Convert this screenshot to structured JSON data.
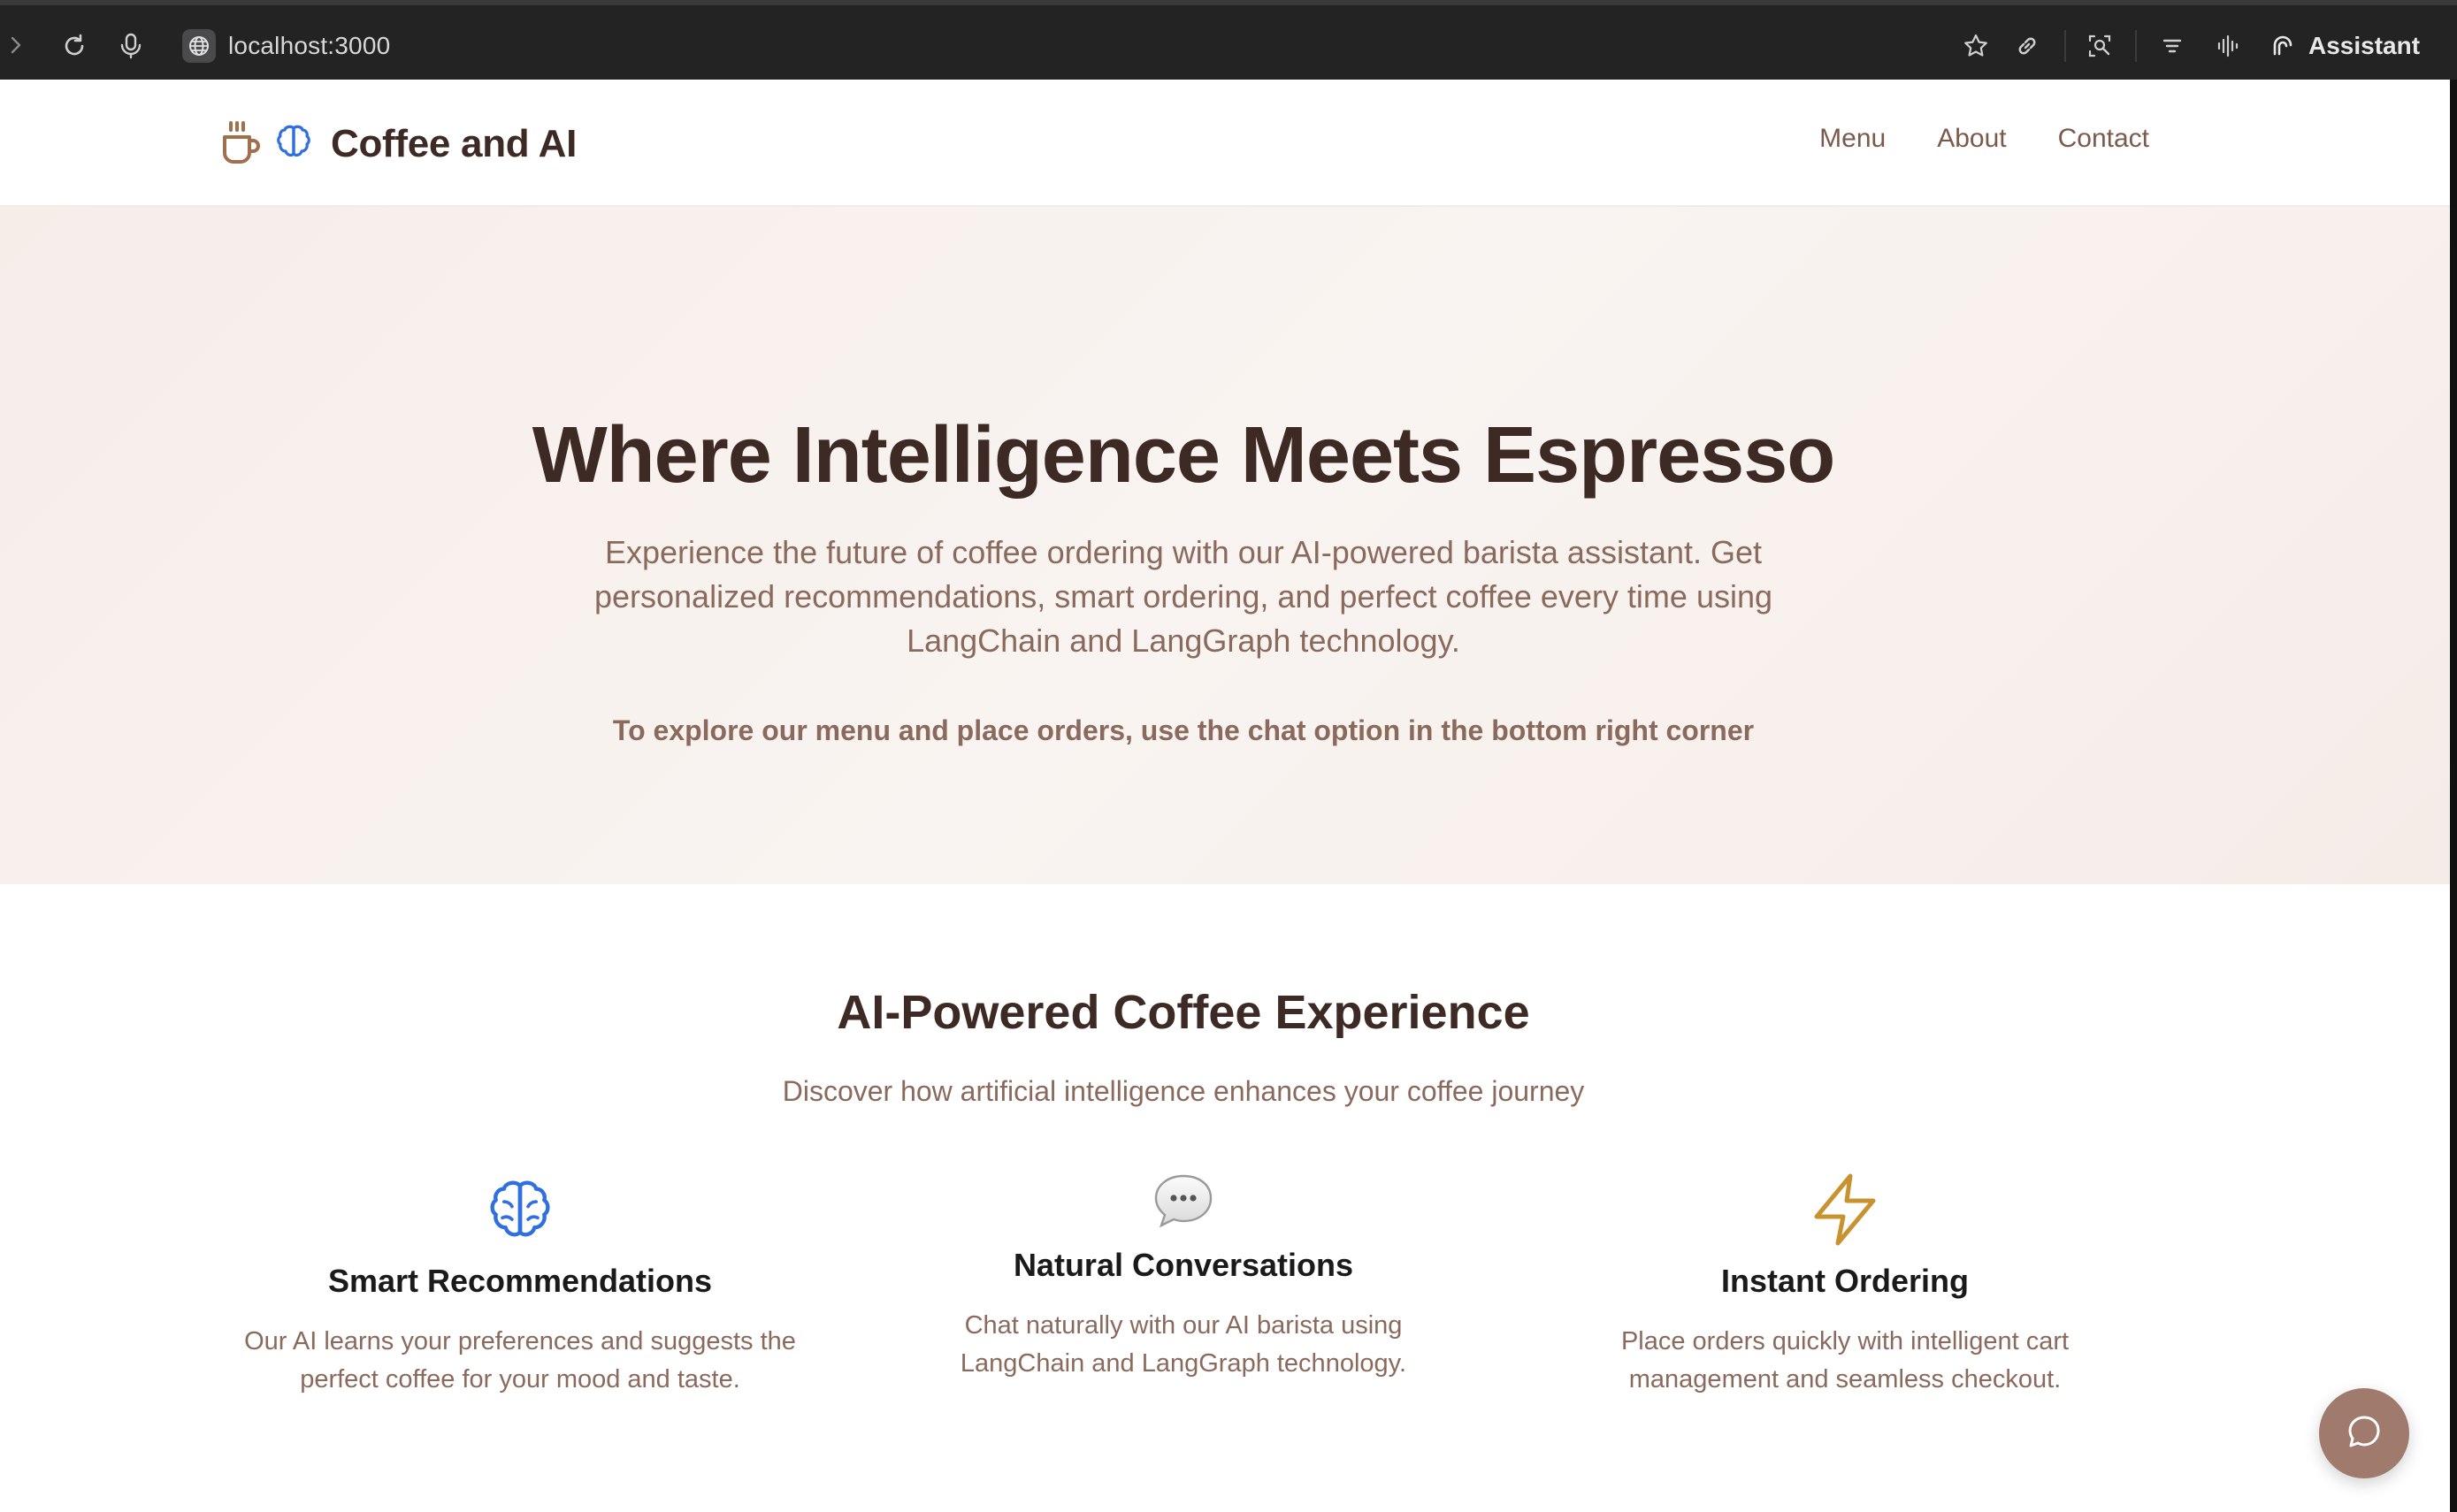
{
  "browser": {
    "url": "localhost:3000",
    "assistant_label": "Assistant"
  },
  "header": {
    "brand_title": "Coffee and AI",
    "nav": [
      "Menu",
      "About",
      "Contact"
    ]
  },
  "hero": {
    "title": "Where Intelligence Meets Espresso",
    "subtitle": "Experience the future of coffee ordering with our AI-powered barista assistant. Get personalized recommendations, smart ordering, and perfect coffee every time using LangChain and LangGraph technology.",
    "note": "To explore our menu and place orders, use the chat option in the bottom right corner"
  },
  "features": {
    "title": "AI-Powered Coffee Experience",
    "subtitle": "Discover how artificial intelligence enhances your coffee journey",
    "items": [
      {
        "icon": "brain-icon",
        "title": "Smart Recommendations",
        "description": "Our AI learns your preferences and suggests the perfect coffee for your mood and taste."
      },
      {
        "icon": "speech-bubble-icon",
        "title": "Natural Conversations",
        "description": "Chat naturally with our AI barista using LangChain and LangGraph technology."
      },
      {
        "icon": "lightning-icon",
        "title": "Instant Ordering",
        "description": "Place orders quickly with intelligent cart management and seamless checkout."
      }
    ]
  },
  "colors": {
    "brand_dark": "#3e2a24",
    "muted_brown": "#8a6a5c",
    "brain_blue": "#2f6fe0",
    "lightning_gold": "#c8922e",
    "chat_button": "#a07a6c"
  }
}
